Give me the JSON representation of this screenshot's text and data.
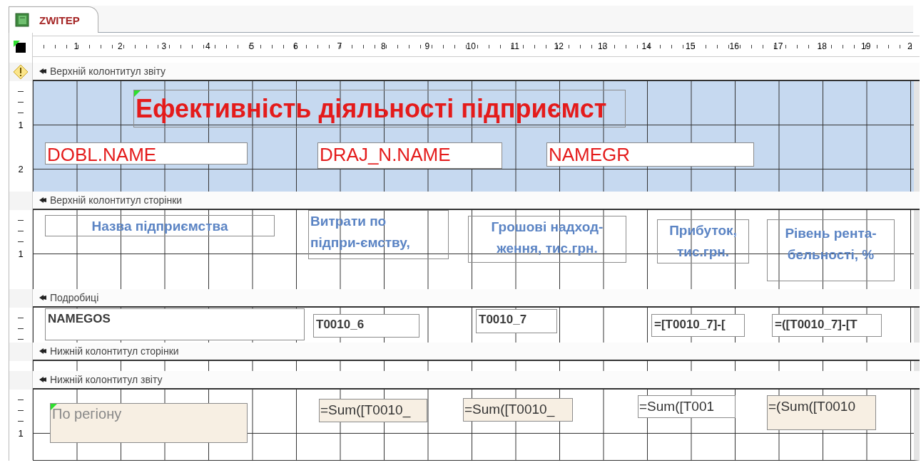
{
  "document_tab": {
    "title": "ZWITEP",
    "selected": true
  },
  "ruler": {
    "labels": [
      "1",
      "2",
      "3",
      "4",
      "5",
      "6",
      "7",
      "8",
      "9",
      "10",
      "11",
      "12",
      "13",
      "14",
      "15",
      "16",
      "17",
      "18",
      "19",
      "2"
    ]
  },
  "sections": [
    {
      "kind": "report_header",
      "title": "Верхній колонтитул звіту",
      "selected": true,
      "warning": true,
      "ruler_marks": [
        "1",
        "2"
      ],
      "controls": [
        {
          "kind": "title",
          "text": "Ефективність діяльності підприємст",
          "error_flag": true,
          "shaded": false
        },
        {
          "kind": "group_field",
          "text": "DOBL.NAME",
          "error_flag": false,
          "shaded": false
        },
        {
          "kind": "group_field",
          "text": "DRAJ_N.NAME",
          "error_flag": false,
          "shaded": false
        },
        {
          "kind": "group_field",
          "text": "NAMEGR",
          "error_flag": false,
          "shaded": false
        }
      ]
    },
    {
      "kind": "page_header",
      "title": "Верхній колонтитул сторінки",
      "selected": false,
      "warning": false,
      "ruler_marks": [
        "1"
      ],
      "controls": [
        {
          "kind": "column_caption",
          "text": "Назва підприємства",
          "error_flag": false,
          "shaded": false
        },
        {
          "kind": "column_caption",
          "text": "Витрати по\nпідпри-ємству,",
          "error_flag": false,
          "shaded": false
        },
        {
          "kind": "column_caption",
          "text": "Грошові надход-\nження, тис.грн.",
          "error_flag": false,
          "shaded": false
        },
        {
          "kind": "column_caption",
          "text": "Прибуток,\nтис.грн.",
          "error_flag": false,
          "shaded": false
        },
        {
          "kind": "column_caption",
          "text": "Рівень рента-\nбельності, %",
          "error_flag": false,
          "shaded": false
        }
      ]
    },
    {
      "kind": "detail",
      "title": "Подробиці",
      "selected": false,
      "warning": false,
      "controls": [
        {
          "kind": "detail_field",
          "text": "NAMEGOS",
          "error_flag": false,
          "shaded": false
        },
        {
          "kind": "detail_field",
          "text": "T0010_6",
          "error_flag": false,
          "shaded": false
        },
        {
          "kind": "detail_field",
          "text": "T0010_7",
          "error_flag": false,
          "shaded": false
        },
        {
          "kind": "detail_field",
          "text": "=[T0010_7]-[",
          "error_flag": false,
          "shaded": false
        },
        {
          "kind": "detail_field",
          "text": "=([T0010_7]-[T",
          "error_flag": false,
          "shaded": false
        }
      ]
    },
    {
      "kind": "page_footer",
      "title": "Нижній колонтитул сторінки",
      "selected": false,
      "warning": false
    },
    {
      "kind": "report_footer",
      "title": "Нижній колонтитул звіту",
      "selected": false,
      "warning": false,
      "ruler_marks": [
        "1"
      ],
      "controls": [
        {
          "kind": "footer_label",
          "text": "По регіону",
          "error_flag": true,
          "shaded": true
        },
        {
          "kind": "sum_field",
          "text": "=Sum([T0010_",
          "error_flag": false,
          "shaded": true
        },
        {
          "kind": "sum_field",
          "text": "=Sum([T0010_",
          "error_flag": false,
          "shaded": true
        },
        {
          "kind": "sum_field",
          "text": "=Sum([T001",
          "error_flag": false,
          "shaded": false
        },
        {
          "kind": "sum_field",
          "text": "=(Sum([T0010",
          "error_flag": false,
          "shaded": true
        }
      ]
    }
  ]
}
